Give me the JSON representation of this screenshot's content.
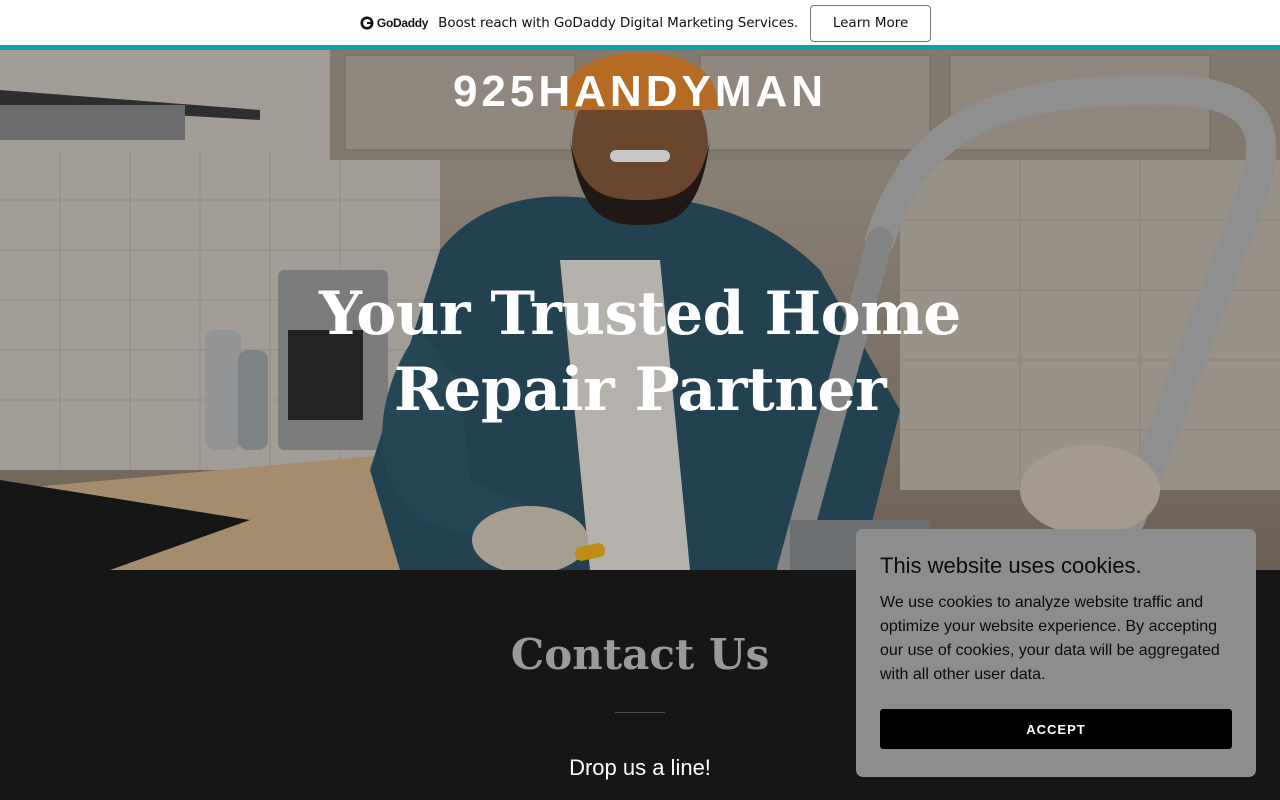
{
  "promo": {
    "logo_text": "GoDaddy",
    "message": "Boost reach with GoDaddy Digital Marketing Services.",
    "cta_label": "Learn More"
  },
  "hero": {
    "brand": "925HANDYMAN",
    "headline": "Your Trusted Home Repair Partner"
  },
  "contact": {
    "title": "Contact Us",
    "subtitle": "Drop us a line!"
  },
  "cookie_banner": {
    "title": "This website uses cookies.",
    "body": "We use cookies to analyze website traffic and optimize your website experience. By accepting our use of cookies, your data will be aggregated with all other user data.",
    "accept_label": "ACCEPT"
  },
  "colors": {
    "accent_line": "#10a0a6",
    "contact_background": "#161616",
    "cookie_background": "#8d8d8d",
    "accept_button": "#000000"
  }
}
